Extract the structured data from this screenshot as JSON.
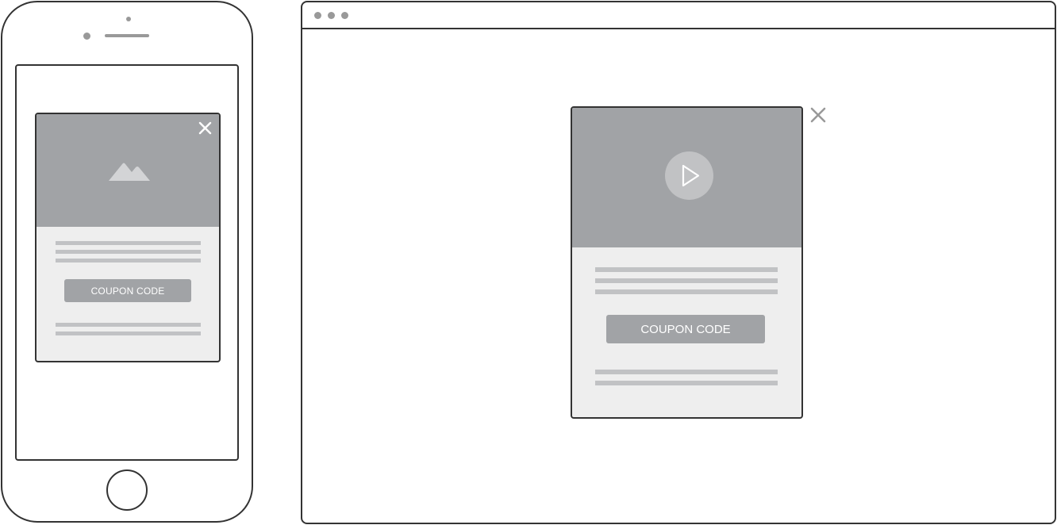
{
  "mobile": {
    "popup": {
      "media_icon": "mountain-image-icon",
      "close_icon": "close-icon",
      "coupon_button_label": "COUPON CODE"
    }
  },
  "desktop": {
    "popup": {
      "media_icon": "play-icon",
      "close_icon": "close-icon",
      "coupon_button_label": "COUPON CODE"
    }
  },
  "colors": {
    "outline": "#333333",
    "media_bg": "#a1a3a6",
    "popup_bg": "#eeeeee",
    "text_placeholder": "#c1c2c4",
    "button_text": "#ffffff"
  }
}
